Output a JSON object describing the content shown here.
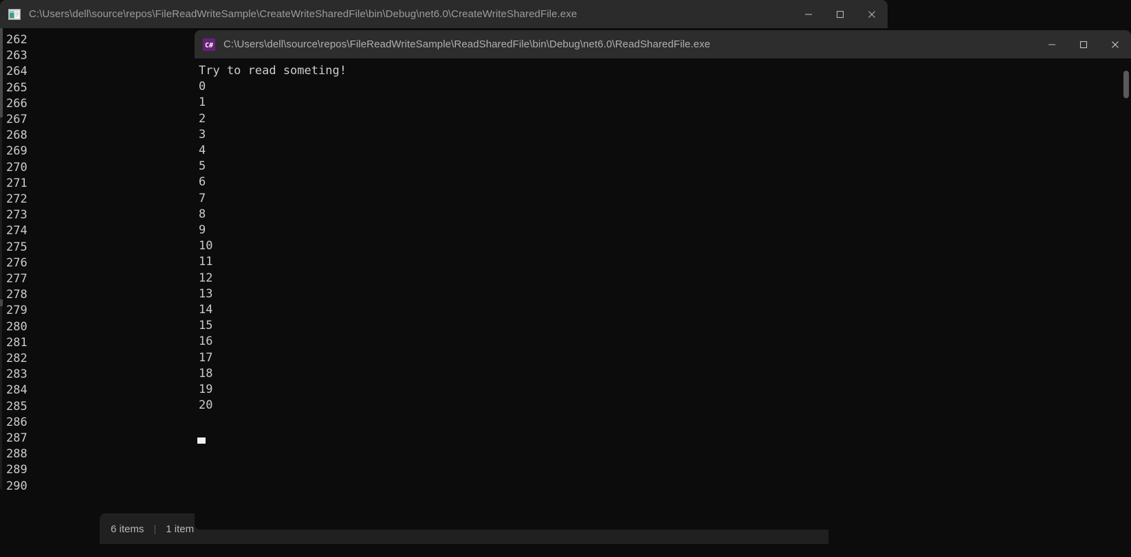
{
  "desktop": {
    "explorer_status": {
      "items_count": "6 items",
      "separator": "|",
      "selected_count": "1 item"
    }
  },
  "windows": [
    {
      "id": "create-write-shared-file",
      "title": "C:\\Users\\dell\\source\\repos\\FileReadWriteSample\\CreateWriteSharedFile\\bin\\Debug\\net6.0\\CreateWriteSharedFile.exe",
      "icon": "console-app-icon",
      "active": false,
      "buttons": {
        "minimize": "minimize-button",
        "maximize": "maximize-button",
        "close": "close-button"
      },
      "console_lines": [
        "262",
        "263",
        "264",
        "265",
        "266",
        "267",
        "268",
        "269",
        "270",
        "271",
        "272",
        "273",
        "274",
        "275",
        "276",
        "277",
        "278",
        "279",
        "280",
        "281",
        "282",
        "283",
        "284",
        "285",
        "286",
        "287",
        "288",
        "289",
        "290"
      ]
    },
    {
      "id": "read-shared-file",
      "title": "C:\\Users\\dell\\source\\repos\\FileReadWriteSample\\ReadSharedFile\\bin\\Debug\\net6.0\\ReadSharedFile.exe",
      "icon": "csharp-icon",
      "icon_label": "C#",
      "active": true,
      "buttons": {
        "minimize": "minimize-button",
        "maximize": "maximize-button",
        "close": "close-button"
      },
      "console_lines": [
        "Try to read someting!",
        "0",
        "1",
        "2",
        "3",
        "4",
        "5",
        "6",
        "7",
        "8",
        "9",
        "10",
        "11",
        "12",
        "13",
        "14",
        "15",
        "16",
        "17",
        "18",
        "19",
        "20"
      ]
    }
  ],
  "colors": {
    "console_bg": "#0c0c0c",
    "console_fg": "#cccccc",
    "titlebar_bg": "#2b2b2b",
    "titlebar_fg": "#9c9c9c",
    "csharp_accent": "#68217a",
    "cursor": "#f2f2f2"
  }
}
